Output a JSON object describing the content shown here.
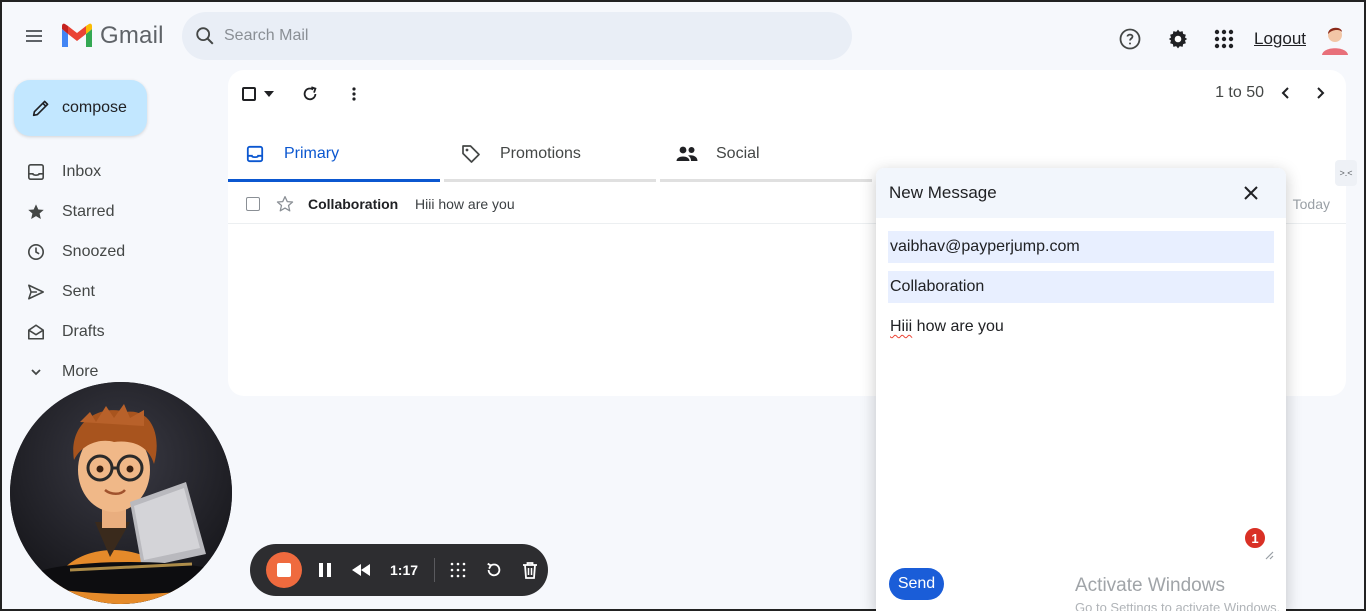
{
  "header": {
    "app_name": "Gmail",
    "search_placeholder": "Search Mail",
    "logout_label": "Logout"
  },
  "sidebar": {
    "compose_label": "compose",
    "items": [
      {
        "label": "Inbox",
        "icon": "inbox-icon"
      },
      {
        "label": "Starred",
        "icon": "star-icon"
      },
      {
        "label": "Snoozed",
        "icon": "clock-icon"
      },
      {
        "label": "Sent",
        "icon": "send-icon"
      },
      {
        "label": "Drafts",
        "icon": "drafts-icon"
      },
      {
        "label": "More",
        "icon": "chevron-down-icon"
      }
    ]
  },
  "toolbar": {
    "pagination": "1 to 50"
  },
  "tabs": [
    {
      "label": "Primary",
      "icon": "inbox-icon",
      "active": true
    },
    {
      "label": "Promotions",
      "icon": "tag-icon",
      "active": false
    },
    {
      "label": "Social",
      "icon": "people-icon",
      "active": false
    }
  ],
  "emails": [
    {
      "sender": "Collaboration",
      "snippet": "Hiii how are you",
      "date": "Today"
    }
  ],
  "compose_dialog": {
    "title": "New Message",
    "to": "vaibhav@payperjump.com",
    "subject": "Collaboration",
    "body_first": "Hiii",
    "body_rest": " how are you",
    "send_label": "Send",
    "badge_count": "1"
  },
  "side_toggle_label": ">.<",
  "watermark": {
    "line1": "Activate Windows",
    "line2": "Go to Settings to activate Windows."
  },
  "recorder": {
    "elapsed": "1:17"
  },
  "colors": {
    "accent": "#0b57d0",
    "compose_bg": "#c2e7ff",
    "search_bg": "#e9eef6",
    "send_button": "#1a5dd8",
    "record_stop": "#ef6a3e"
  }
}
